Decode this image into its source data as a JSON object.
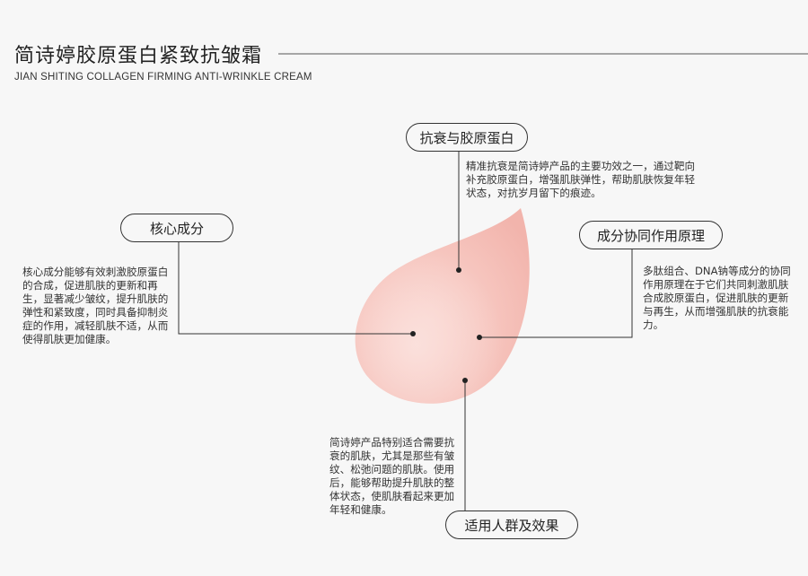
{
  "header": {
    "title": "简诗婷胶原蛋白紧致抗皱霜",
    "subtitle": "JIAN SHITING COLLAGEN FIRMING ANTI-WRINKLE CREAM"
  },
  "sections": [
    {
      "label": "抗衰与胶原蛋白",
      "text": "精准抗衰是简诗婷产品的主要功效之一，通过靶向补充胶原蛋白，增强肌肤弹性，帮助肌肤恢复年轻状态，对抗岁月留下的痕迹。"
    },
    {
      "label": "核心成分",
      "text": "核心成分能够有效刺激胶原蛋白的合成，促进肌肤的更新和再生，显著减少皱纹，提升肌肤的弹性和紧致度，同时具备抑制炎症的作用，减轻肌肤不适，从而使得肌肤更加健康。"
    },
    {
      "label": "成分协同作用原理",
      "text": "多肽组合、DNA钠等成分的协同作用原理在于它们共同刺激肌肤合成胶原蛋白，促进肌肤的更新与再生，从而增强肌肤的抗衰能力。"
    },
    {
      "label": "适用人群及效果",
      "text": "简诗婷产品特别适合需要抗衰的肌肤，尤其是那些有皱纹、松弛问题的肌肤。使用后，能够帮助提升肌肤的整体状态，使肌肤看起来更加年轻和健康。"
    }
  ],
  "colors": {
    "background": "#f7f7f7",
    "drop": "#f6c6c0",
    "line": "#333333"
  }
}
